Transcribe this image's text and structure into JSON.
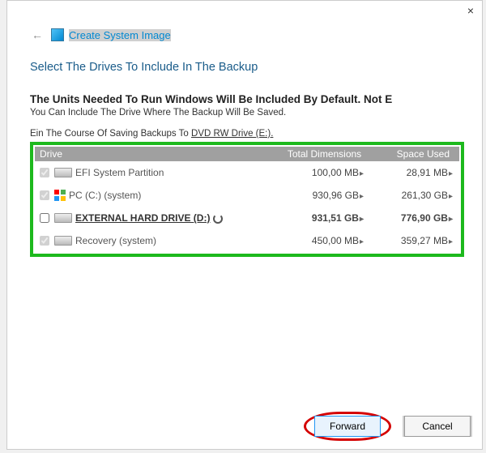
{
  "window": {
    "title": "Create System Image",
    "close_label": "×"
  },
  "content": {
    "heading": "Select The Drives To Include In The Backup",
    "subhead": "The Units Needed To Run Windows Will Be Included By Default. Not E",
    "subtext": "You Can Include The Drive Where The Backup Will Be Saved.",
    "saving_prefix": "Ein The Course Of Saving Backups To ",
    "saving_drive": "DVD RW Drive (E:).",
    "columns": {
      "drive": "Drive",
      "total": "Total Dimensions",
      "used": "Space Used"
    },
    "rows": [
      {
        "checked": true,
        "disabled": true,
        "icon": "drive",
        "name": "EFI System Partition",
        "total": "100,00 MB",
        "used": "28,91 MB",
        "bold": false
      },
      {
        "checked": true,
        "disabled": true,
        "icon": "windows",
        "name": "PC (C:) (system)",
        "total": "930,96 GB",
        "used": "261,30 GB",
        "bold": false
      },
      {
        "checked": false,
        "disabled": false,
        "icon": "drive",
        "name": "EXTERNAL HARD DRIVE (D:)",
        "total": "931,51 GB",
        "used": "776,90 GB",
        "bold": true,
        "spinner": true
      },
      {
        "checked": true,
        "disabled": true,
        "icon": "drive",
        "name": "Recovery (system)",
        "total": "450,00 MB",
        "used": "359,27 MB",
        "bold": false
      }
    ]
  },
  "footer": {
    "forward": "Forward",
    "cancel": "Cancel"
  }
}
